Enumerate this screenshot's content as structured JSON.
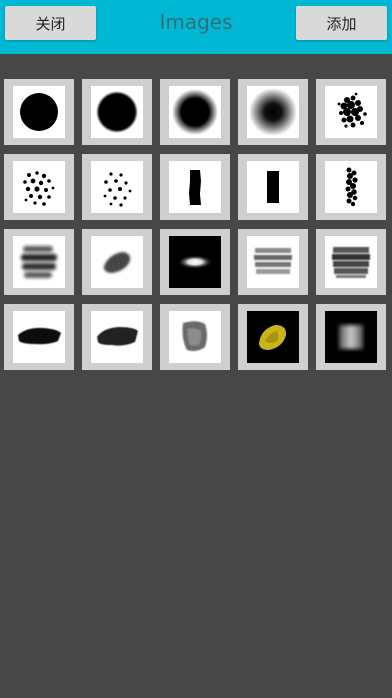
{
  "header": {
    "title": "Images",
    "close_label": "关闭",
    "add_label": "添加"
  },
  "brushes": [
    {
      "name": "hard-round-brush",
      "bg": "#ffffff"
    },
    {
      "name": "round-brush",
      "bg": "#ffffff"
    },
    {
      "name": "soft-round-brush",
      "bg": "#ffffff"
    },
    {
      "name": "airbrush",
      "bg": "#ffffff"
    },
    {
      "name": "spatter-brush",
      "bg": "#ffffff"
    },
    {
      "name": "dots-brush",
      "bg": "#ffffff"
    },
    {
      "name": "sparse-dots-brush",
      "bg": "#ffffff"
    },
    {
      "name": "rough-rect-brush",
      "bg": "#ffffff"
    },
    {
      "name": "rect-brush",
      "bg": "#ffffff"
    },
    {
      "name": "dotted-column-brush",
      "bg": "#ffffff"
    },
    {
      "name": "smudge-brush",
      "bg": "#ffffff"
    },
    {
      "name": "small-smudge-brush",
      "bg": "#ffffff"
    },
    {
      "name": "glow-ellipse-brush",
      "bg": "#000000"
    },
    {
      "name": "grey-texture-brush",
      "bg": "#ffffff"
    },
    {
      "name": "dark-texture-brush",
      "bg": "#ffffff"
    },
    {
      "name": "paint-stroke-brush",
      "bg": "#ffffff"
    },
    {
      "name": "paint-stroke-brush-2",
      "bg": "#ffffff"
    },
    {
      "name": "stone-texture-brush",
      "bg": "#ffffff"
    },
    {
      "name": "yellow-blob-brush",
      "bg": "#000000"
    },
    {
      "name": "soft-square-brush",
      "bg": "#000000"
    }
  ]
}
